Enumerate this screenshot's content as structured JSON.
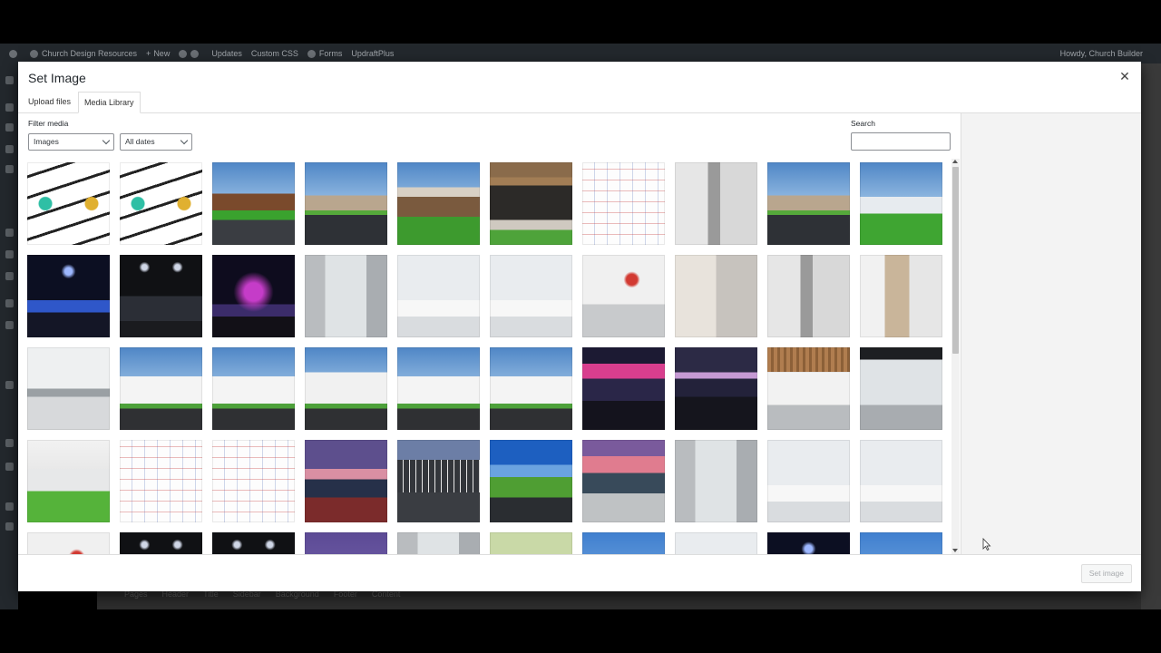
{
  "adminbar": {
    "site_name": "Church Design Resources",
    "new_label": "New",
    "updates_label": "Updates",
    "custom_css_label": "Custom CSS",
    "forms_label": "Forms",
    "updraft_label": "UpdraftPlus",
    "greeting": "Howdy, Church Builder"
  },
  "background_tabs": [
    "Pages",
    "Header",
    "Title",
    "Sidebar",
    "Background",
    "Footer",
    "Content"
  ],
  "modal": {
    "title": "Set Image",
    "tabs": [
      {
        "label": "Upload files",
        "active": false
      },
      {
        "label": "Media Library",
        "active": true
      }
    ],
    "filter_label": "Filter media",
    "type_filter": "Images",
    "date_filter": "All dates",
    "search_label": "Search",
    "search_value": "",
    "set_button_label": "Set image"
  },
  "media_items": [
    {
      "kind": "logo"
    },
    {
      "kind": "logo"
    },
    {
      "kind": "exterior-brown"
    },
    {
      "kind": "exterior-lot"
    },
    {
      "kind": "exterior-stone"
    },
    {
      "kind": "entrance"
    },
    {
      "kind": "floorplan"
    },
    {
      "kind": "lobby-dark"
    },
    {
      "kind": "exterior-lot"
    },
    {
      "kind": "exterior-white"
    },
    {
      "kind": "auditorium-blue"
    },
    {
      "kind": "auditorium-dark"
    },
    {
      "kind": "auditorium-purple"
    },
    {
      "kind": "hallway"
    },
    {
      "kind": "lobby-bright"
    },
    {
      "kind": "lobby-bright"
    },
    {
      "kind": "lobby-red"
    },
    {
      "kind": "lobby-warm"
    },
    {
      "kind": "lobby-dark"
    },
    {
      "kind": "room-shelves"
    },
    {
      "kind": "lobby-gray"
    },
    {
      "kind": "building-white"
    },
    {
      "kind": "building-white"
    },
    {
      "kind": "building-plain"
    },
    {
      "kind": "building-white"
    },
    {
      "kind": "building-white"
    },
    {
      "kind": "chapel-pink"
    },
    {
      "kind": "chapel-dark"
    },
    {
      "kind": "lobby-ceiling"
    },
    {
      "kind": "lobby-atrium"
    },
    {
      "kind": "exterior-white-lawn"
    },
    {
      "kind": "floorplan"
    },
    {
      "kind": "floorplan"
    },
    {
      "kind": "dusk-lot"
    },
    {
      "kind": "aerial-lot"
    },
    {
      "kind": "aerial-green"
    },
    {
      "kind": "sunset-plaza"
    },
    {
      "kind": "hallway"
    },
    {
      "kind": "lobby-bright"
    },
    {
      "kind": "lobby-bright"
    },
    {
      "kind": "lobby-red"
    },
    {
      "kind": "auditorium-dark"
    },
    {
      "kind": "auditorium-dark"
    },
    {
      "kind": "purple-sky"
    },
    {
      "kind": "hallway"
    },
    {
      "kind": "green-field"
    },
    {
      "kind": "blue-sky"
    },
    {
      "kind": "lobby-bright"
    },
    {
      "kind": "auditorium-blue"
    },
    {
      "kind": "blue-sky"
    }
  ]
}
